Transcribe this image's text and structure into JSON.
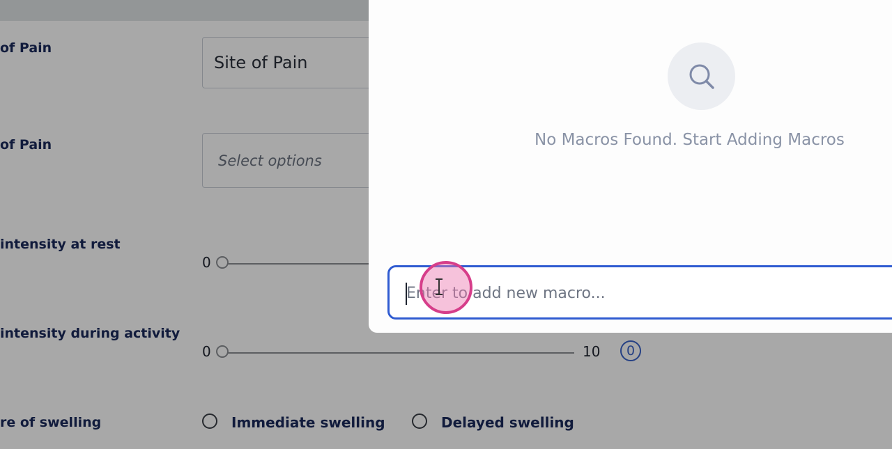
{
  "form": {
    "fields": [
      {
        "label": "of Pain",
        "value": "Site of Pain"
      },
      {
        "label": "of Pain",
        "placeholder": "Select options"
      }
    ],
    "sliders": [
      {
        "label": "intensity at rest",
        "min_label": "0"
      },
      {
        "label": "intensity during activity",
        "min_label": "0",
        "max_label": "10",
        "badge": "0"
      }
    ],
    "swelling": {
      "label": "re of swelling",
      "options": [
        "Immediate swelling",
        "Delayed swelling"
      ]
    }
  },
  "macro_panel": {
    "empty_icon": "search-icon",
    "empty_message": "No Macros Found. Start Adding Macros",
    "input_placeholder": "Enter to add new macro...",
    "input_value": ""
  },
  "colors": {
    "accent": "#2f5bd1",
    "label": "#1b2a5c",
    "click_marker": "#d63e8a"
  }
}
